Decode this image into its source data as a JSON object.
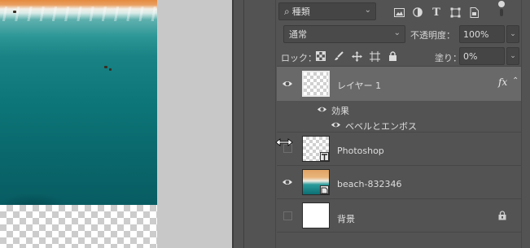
{
  "filter": {
    "label": "種類"
  },
  "blend": {
    "mode": "通常",
    "opacity_label": "不透明度：",
    "opacity_value": "100%"
  },
  "lock": {
    "label": "ロック：",
    "fill_label": "塗り：",
    "fill_value": "0%"
  },
  "layers": [
    {
      "name": "レイヤー 1",
      "visible": true,
      "selected": true,
      "fx": "fx"
    },
    {
      "name": "Photoshop",
      "visible": false
    },
    {
      "name": "beach-832346",
      "visible": true
    },
    {
      "name": "背景",
      "visible": false,
      "locked": true
    }
  ],
  "effects": {
    "label": "効果",
    "items": [
      "ベベルとエンボス"
    ]
  },
  "colors": {
    "panel_bg": "#535353",
    "selected_row": "#696969",
    "canvas_bg": "#c8c8c8",
    "sea": "#0d7779"
  }
}
